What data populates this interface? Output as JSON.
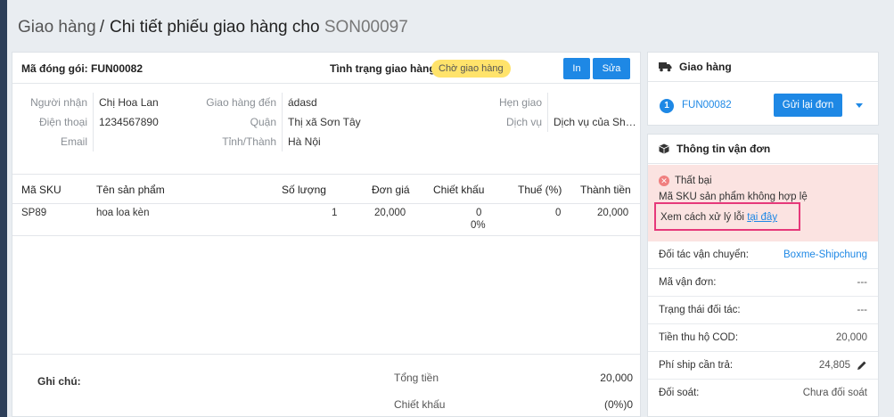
{
  "header": {
    "crumb": "Giao hàng",
    "separator": "/",
    "title": "Chi tiết phiếu giao hàng cho",
    "code": "SON00097"
  },
  "shipment": {
    "package_label": "Mã đóng gói: FUN00082",
    "status_label": "Tình trạng giao hàng",
    "status_badge": "Chờ giao hàng",
    "print_label": "In",
    "edit_label": "Sửa"
  },
  "info": {
    "col1": [
      {
        "label": "Người nhận",
        "value": "Chị Hoa Lan"
      },
      {
        "label": "Điện thoại",
        "value": "1234567890"
      },
      {
        "label": "Email",
        "value": ""
      }
    ],
    "col2": [
      {
        "label": "Giao hàng đến",
        "value": "ádasd"
      },
      {
        "label": "Quận",
        "value": "Thị xã Sơn Tây"
      },
      {
        "label": "Tỉnh/Thành",
        "value": "Hà Nội"
      }
    ],
    "col3": [
      {
        "label": "Hẹn giao",
        "value": ""
      },
      {
        "label": "Dịch vụ",
        "value": "Dịch vụ của Ship..."
      }
    ]
  },
  "table": {
    "columns": [
      "Mã SKU",
      "Tên sản phẩm",
      "Số lượng",
      "Đơn giá",
      "Chiết khấu",
      "Thuế (%)",
      "Thành tiền"
    ],
    "rows": [
      {
        "sku": "SP89",
        "name": "hoa loa kèn",
        "qty": "1",
        "price": "20,000",
        "discount": "0",
        "discount_pct": "0%",
        "tax": "0",
        "total": "20,000"
      }
    ]
  },
  "footer": {
    "note_label": "Ghi chú:",
    "total_label": "Tổng tiền",
    "total_value": "20,000",
    "discount_label": "Chiết khấu",
    "discount_value": "(0%)0"
  },
  "side_delivery": {
    "title": "Giao hàng",
    "index": "1",
    "code": "FUN00082",
    "resend_label": "Gửi lại đơn"
  },
  "side_waybill": {
    "title": "Thông tin vận đơn",
    "alert_title": "Thất bại",
    "alert_message": "Mã SKU sản phẩm không hợp lệ",
    "help_text": "Xem cách xử lý lỗi",
    "help_link": "tại đây",
    "rows": [
      {
        "label": "Đối tác vận chuyển:",
        "value": "Boxme-Shipchung"
      },
      {
        "label": "Mã vận đơn:",
        "value": "---"
      },
      {
        "label": "Trạng thái đối tác:",
        "value": "---"
      },
      {
        "label": "Tiền thu hộ COD:",
        "value": "20,000"
      },
      {
        "label": "Phí ship cần trả:",
        "value": "24,805"
      },
      {
        "label": "Đối soát:",
        "value": "Chưa đối soát"
      }
    ]
  },
  "colors": {
    "primary": "#1e88e5",
    "badge": "#ffe36b",
    "alert_bg": "#fbe3e1",
    "highlight_border": "#e6397a"
  }
}
